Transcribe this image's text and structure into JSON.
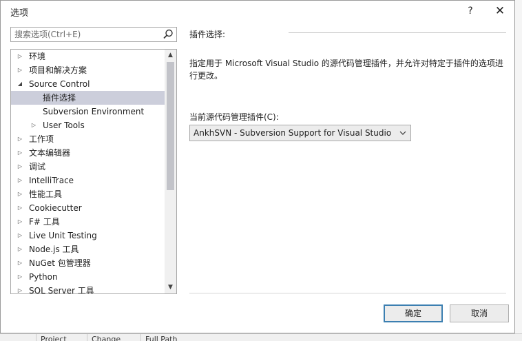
{
  "dialog": {
    "title": "选项",
    "help_label": "?",
    "close_label": "✕"
  },
  "search": {
    "placeholder": "搜索选项(Ctrl+E)",
    "value": ""
  },
  "tree": {
    "items": [
      {
        "label": "环境",
        "level": 0,
        "expander": "collapsed",
        "selected": false
      },
      {
        "label": "项目和解决方案",
        "level": 0,
        "expander": "collapsed",
        "selected": false
      },
      {
        "label": "Source Control",
        "level": 0,
        "expander": "expanded",
        "selected": false
      },
      {
        "label": "插件选择",
        "level": 1,
        "expander": "none",
        "selected": true
      },
      {
        "label": "Subversion Environment",
        "level": 1,
        "expander": "none",
        "selected": false
      },
      {
        "label": "User Tools",
        "level": 1,
        "expander": "collapsed",
        "selected": false
      },
      {
        "label": "工作项",
        "level": 0,
        "expander": "collapsed",
        "selected": false
      },
      {
        "label": "文本编辑器",
        "level": 0,
        "expander": "collapsed",
        "selected": false
      },
      {
        "label": "调试",
        "level": 0,
        "expander": "collapsed",
        "selected": false
      },
      {
        "label": "IntelliTrace",
        "level": 0,
        "expander": "collapsed",
        "selected": false
      },
      {
        "label": "性能工具",
        "level": 0,
        "expander": "collapsed",
        "selected": false
      },
      {
        "label": "Cookiecutter",
        "level": 0,
        "expander": "collapsed",
        "selected": false
      },
      {
        "label": "F# 工具",
        "level": 0,
        "expander": "collapsed",
        "selected": false
      },
      {
        "label": "Live Unit Testing",
        "level": 0,
        "expander": "collapsed",
        "selected": false
      },
      {
        "label": "Node.js 工具",
        "level": 0,
        "expander": "collapsed",
        "selected": false
      },
      {
        "label": "NuGet 包管理器",
        "level": 0,
        "expander": "collapsed",
        "selected": false
      },
      {
        "label": "Python",
        "level": 0,
        "expander": "collapsed",
        "selected": false
      },
      {
        "label": "SQL Server 工具",
        "level": 0,
        "expander": "collapsed",
        "selected": false
      }
    ]
  },
  "panel": {
    "section_title": "插件选择:",
    "description": "指定用于 Microsoft Visual Studio 的源代码管理插件，并允许对特定于插件的选项进行更改。",
    "plugin_label": "当前源代码管理插件(C):",
    "plugin_value": "AnkhSVN - Subversion Support for Visual Studio"
  },
  "buttons": {
    "ok": "确定",
    "cancel": "取消"
  },
  "background": {
    "bottom_columns": [
      "Project",
      "Change",
      "Full Path"
    ]
  },
  "colors": {
    "selected_row": "#cccedb",
    "primary_border": "#3c7fb1"
  }
}
